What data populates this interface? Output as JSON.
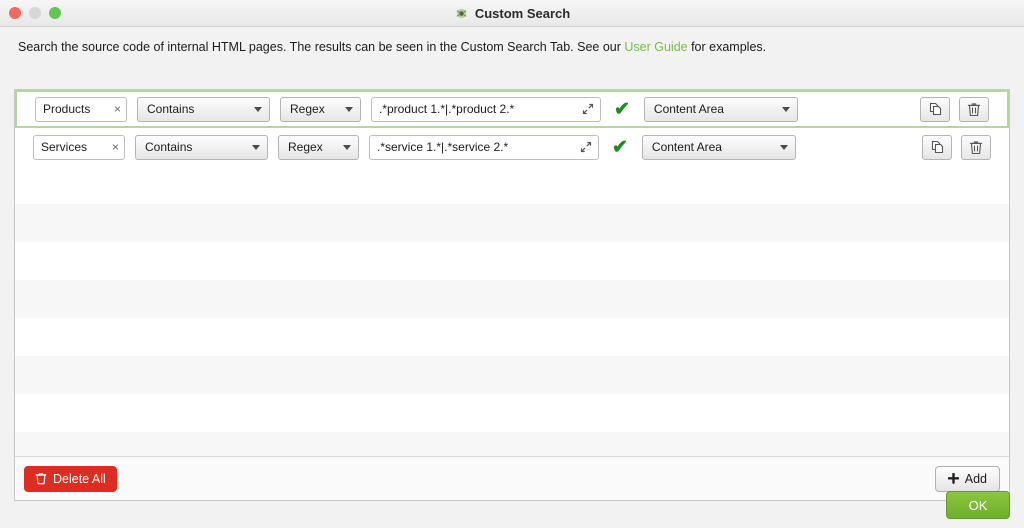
{
  "window": {
    "title": "Custom Search",
    "icon": "spider-frog-icon",
    "controls": {
      "close": "close",
      "minimize": "minimize",
      "maximize": "maximize"
    }
  },
  "description": {
    "before_link": "Search the source code of internal HTML pages. The results can be seen in the Custom Search Tab. See our ",
    "link_text": "User Guide",
    "after_link": " for examples."
  },
  "colors": {
    "accent_green": "#78bf3b",
    "ok_green": "#7cbb34",
    "delete_red": "#e02b20",
    "check_green": "#1f8a24",
    "selection_border": "#b4d79b"
  },
  "rows": [
    {
      "name": "Products",
      "clear_label": "×",
      "match_type": "Contains",
      "format": "Regex",
      "value": ".*product 1.*|.*product 2.*",
      "value_placeholder": "",
      "valid": true,
      "valid_mark": "✔",
      "scope": "Content Area",
      "expand_icon": "expand-arrows-icon",
      "duplicate_icon": "duplicate-icon",
      "delete_icon": "trash-icon",
      "selected": true
    },
    {
      "name": "Services",
      "clear_label": "×",
      "match_type": "Contains",
      "format": "Regex",
      "value": ".*service 1.*|.*service 2.*",
      "value_placeholder": "",
      "valid": true,
      "valid_mark": "✔",
      "scope": "Content Area",
      "expand_icon": "expand-arrows-icon",
      "duplicate_icon": "duplicate-icon",
      "delete_icon": "trash-icon",
      "selected": false
    }
  ],
  "empty_row_count": 8,
  "footer": {
    "delete_all_label": "Delete All",
    "delete_all_icon": "trash-icon",
    "add_label": "Add",
    "add_icon": "plus-icon"
  },
  "ok_button": {
    "label": "OK"
  }
}
